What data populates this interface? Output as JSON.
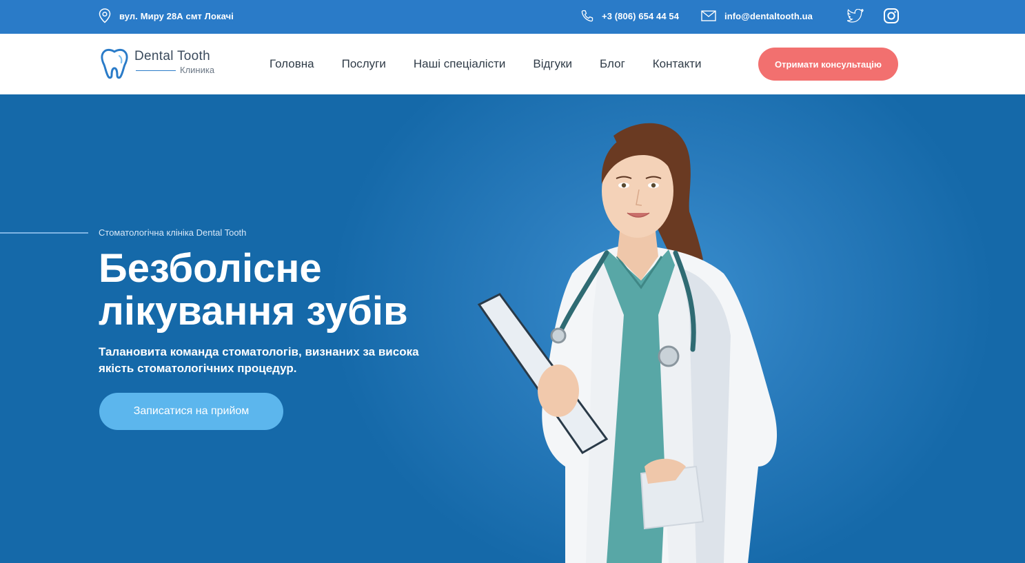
{
  "topbar": {
    "address": "вул. Миру 28А смт Локачі",
    "phone": "+3 (806) 654 44 54",
    "email": "info@dentaltooth.ua",
    "social": [
      "twitter-icon",
      "instagram-icon"
    ]
  },
  "header": {
    "logo": {
      "name": "Dental Tooth",
      "subtitle": "Клиника"
    },
    "nav": [
      "Головна",
      "Послуги",
      "Наші спеціалісти",
      "Відгуки",
      "Блог",
      "Контакти"
    ],
    "cta": "Отримати консультацію"
  },
  "hero": {
    "tagline": "Стоматологічна клініка Dental Tooth",
    "title": "Безболісне лікування зубів",
    "description": "Талановита команда стоматологів, визнаних за висока якість стоматологічних процедур.",
    "button": "Записатися на прийом"
  },
  "colors": {
    "topbar": "#2a7bc8",
    "accent_cta": "#f2706f",
    "hero_bg": "#1a6fb0",
    "hero_button": "#5cb6ed"
  }
}
